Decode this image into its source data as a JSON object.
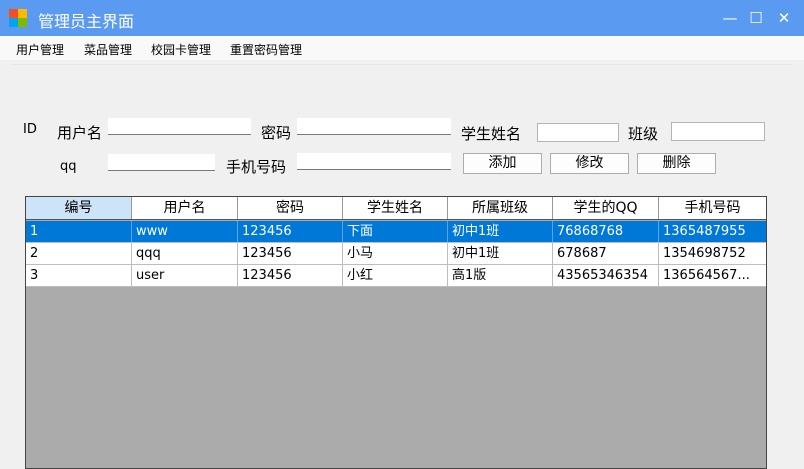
{
  "window": {
    "title": "管理员主界面",
    "minimize": "—",
    "maximize": "☐",
    "close": "✕"
  },
  "menu": [
    "用户管理",
    "菜品管理",
    "校园卡管理",
    "重置密码管理"
  ],
  "form": {
    "id_label": "ID",
    "username_label": "用户名",
    "password_label": "密码",
    "student_name_label": "学生姓名",
    "class_label": "班级",
    "qq_label": "qq",
    "phone_label": "手机号码",
    "add_button": "添加",
    "edit_button": "修改",
    "delete_button": "删除"
  },
  "table": {
    "columns": [
      "编号",
      "用户名",
      "密码",
      "学生姓名",
      "所属班级",
      "学生的QQ",
      "手机号码"
    ],
    "rows": [
      [
        "1",
        "www",
        "123456",
        "下面",
        "初中1班",
        "76868768",
        "1365487955"
      ],
      [
        "2",
        "qqq",
        "123456",
        "小马",
        "初中1班",
        "678687",
        "1354698752"
      ],
      [
        "3",
        "user",
        "123456",
        "小红",
        "高1版",
        "43565346354",
        "136564567..."
      ]
    ]
  }
}
